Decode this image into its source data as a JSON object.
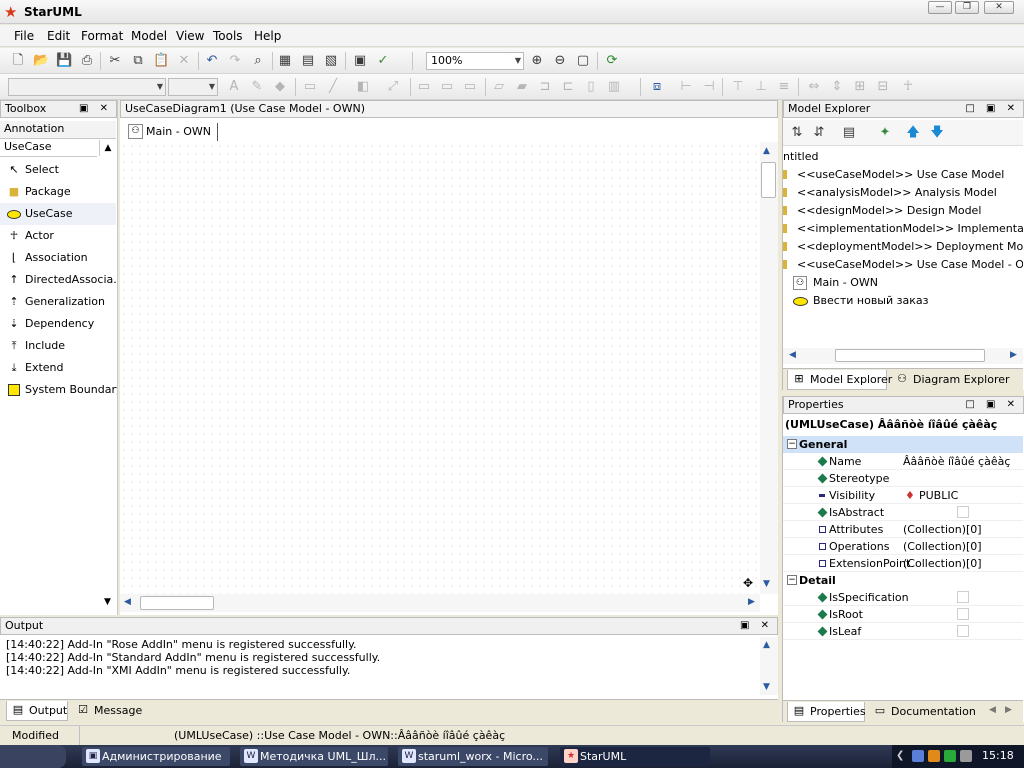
{
  "window": {
    "title": "StarUML",
    "minimize": "—",
    "maximize": "❐",
    "close": "✕"
  },
  "menu": [
    "File",
    "Edit",
    "Format",
    "Model",
    "View",
    "Tools",
    "Help"
  ],
  "toolbar": {
    "zoom": "100%"
  },
  "toolbox": {
    "title": "Toolbox",
    "categories": [
      "Annotation",
      "UseCase"
    ],
    "items": [
      {
        "label": "Select",
        "icon": "cursor-icon"
      },
      {
        "label": "Package",
        "icon": "folder-icon"
      },
      {
        "label": "UseCase",
        "icon": "ellipse-icon"
      },
      {
        "label": "Actor",
        "icon": "actor-icon"
      },
      {
        "label": "Association",
        "icon": "association-icon"
      },
      {
        "label": "DirectedAssocia...",
        "icon": "directed-association-icon"
      },
      {
        "label": "Generalization",
        "icon": "generalization-icon"
      },
      {
        "label": "Dependency",
        "icon": "dependency-icon"
      },
      {
        "label": "Include",
        "icon": "include-icon"
      },
      {
        "label": "Extend",
        "icon": "extend-icon"
      },
      {
        "label": "System Boundary",
        "icon": "system-boundary-icon"
      }
    ]
  },
  "diagram": {
    "title": "UseCaseDiagram1 (Use Case Model - OWN)",
    "tab": "Main - OWN"
  },
  "model_explorer": {
    "title": "Model Explorer",
    "root": "ntitled",
    "rows": [
      "<<useCaseModel>> Use Case Model",
      "<<analysisModel>> Analysis Model",
      "<<designModel>> Design Model",
      "<<implementationModel>> Implementation Mo",
      "<<deploymentModel>> Deployment Model",
      "<<useCaseModel>> Use Case Model - OWN"
    ],
    "children": [
      "Main - OWN",
      "Ввести новый заказ"
    ],
    "tabs": [
      "Model Explorer",
      "Diagram Explorer"
    ]
  },
  "properties": {
    "title": "Properties",
    "header": "(UMLUseCase) Âââñòè íîâûé çàêàç",
    "groups": [
      {
        "name": "General",
        "rows": [
          {
            "name": "Name",
            "value": "Âââñòè íîâûé çàêàç"
          },
          {
            "name": "Stereotype",
            "value": ""
          },
          {
            "name": "Visibility",
            "value": "PUBLIC"
          },
          {
            "name": "IsAbstract",
            "value": ""
          },
          {
            "name": "Attributes",
            "value": "(Collection)[0]"
          },
          {
            "name": "Operations",
            "value": "(Collection)[0]"
          },
          {
            "name": "ExtensionPoint",
            "value": "(Collection)[0]"
          }
        ]
      },
      {
        "name": "Detail",
        "rows": [
          {
            "name": "IsSpecification",
            "value": ""
          },
          {
            "name": "IsRoot",
            "value": ""
          },
          {
            "name": "IsLeaf",
            "value": ""
          }
        ]
      }
    ],
    "tabs": [
      "Properties",
      "Documentation"
    ]
  },
  "output": {
    "title": "Output",
    "lines": [
      "[14:40:22]  Add-In \"Rose AddIn\" menu is registered successfully.",
      "[14:40:22]  Add-In \"Standard AddIn\" menu is registered successfully.",
      "[14:40:22]  Add-In \"XMI AddIn\" menu is registered successfully."
    ],
    "tabs": [
      "Output",
      "Message"
    ]
  },
  "status": {
    "state": "Modified",
    "selection": "(UMLUseCase) ::Use Case Model - OWN::Âââñòè íîâûé çàêàç"
  },
  "taskbar": {
    "tasks": [
      "Администрирование",
      "Методичка UML_Шл...",
      "staruml_worx - Micro...",
      "StarUML"
    ],
    "clock": "15:18"
  }
}
